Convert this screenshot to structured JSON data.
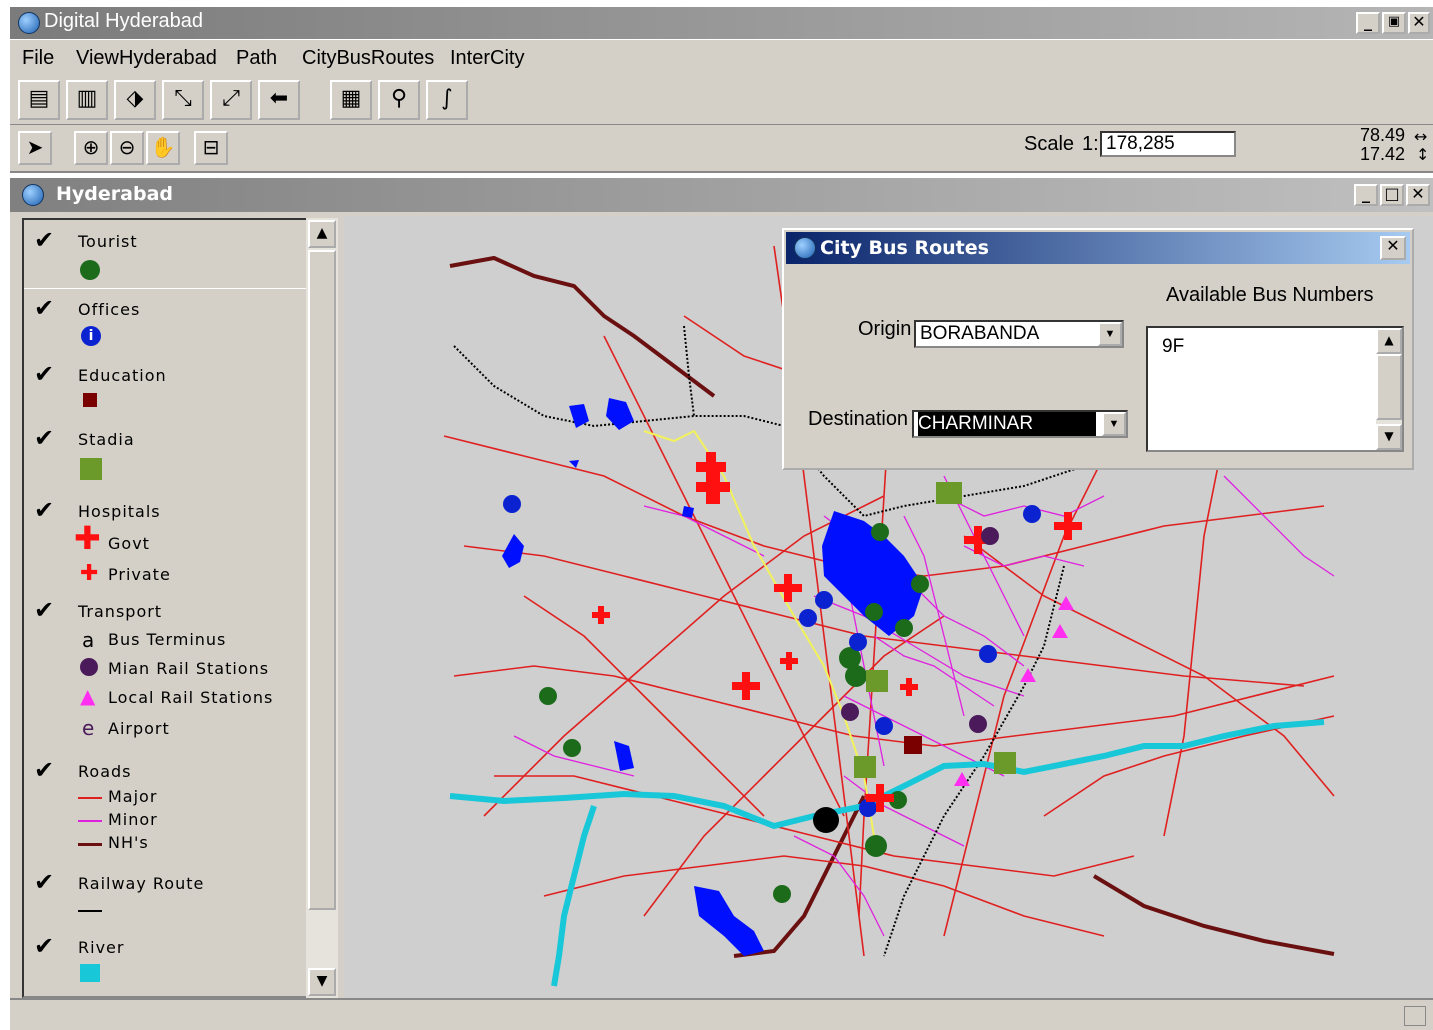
{
  "app": {
    "title": "Digital Hyderabad",
    "window_buttons": [
      "_",
      "🗗",
      "✕"
    ]
  },
  "menu": [
    "File",
    "ViewHyderabad",
    "Path",
    "CityBusRoutes",
    "InterCity"
  ],
  "toolbar2": {
    "scale_label": "Scale",
    "scale_prefix": "1:",
    "scale_value": "178,285",
    "coord_x": "78.49",
    "coord_y": "17.42"
  },
  "map_window": {
    "title": "Hyderabad"
  },
  "legend": {
    "tourist": "Tourist",
    "offices": "Offices",
    "education": "Education",
    "stadia": "Stadia",
    "hospitals": "Hospitals",
    "govt": "Govt",
    "private": "Private",
    "transport": "Transport",
    "bus_terminus": "Bus Terminus",
    "main_rail": "Mian Rail Stations",
    "local_rail": "Local Rail Stations",
    "airport": "Airport",
    "roads": "Roads",
    "major": "Major",
    "minor": "Minor",
    "nhs": "NH's",
    "railway": "Railway Route",
    "river": "River",
    "bus_glyph": "a",
    "airport_glyph": "e"
  },
  "colors": {
    "tourist": "#1b6b1b",
    "offices": "#0a22d0",
    "education": "#7a0000",
    "stadia": "#6b9a2a",
    "hospital": "#ff1010",
    "main_rail": "#4a1a5a",
    "local_rail": "#ff2ef0",
    "major_road": "#e02020",
    "minor_road": "#e020e0",
    "nh": "#6a1010",
    "river": "#18c8d8",
    "lake": "#0010ff",
    "map_bg": "#cfcfcf"
  },
  "dialog": {
    "title": "City Bus Routes",
    "origin_label": "Origin",
    "origin_value": "BORABANDA",
    "destination_label": "Destination",
    "destination_value": "CHARMINAR",
    "available_label": "Available Bus Numbers",
    "bus_numbers": [
      "9F"
    ]
  }
}
